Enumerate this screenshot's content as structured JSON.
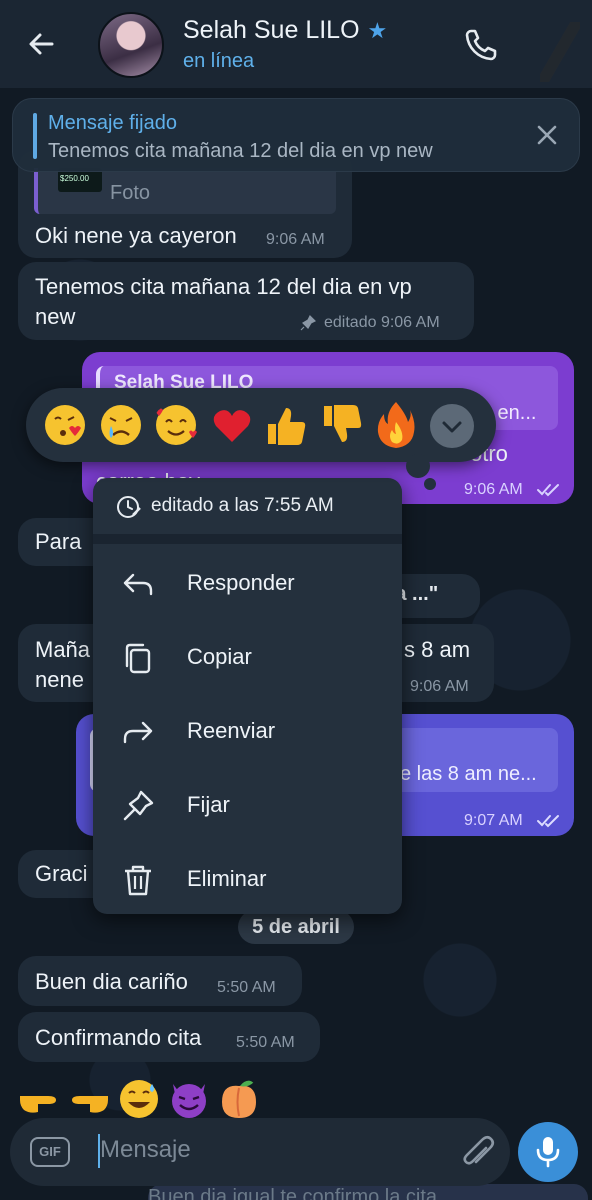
{
  "header": {
    "contact_name": "Selah Sue LILO",
    "status": "en línea"
  },
  "pinned": {
    "title": "Mensaje fijado",
    "text": "Tenemos cita mañana 12 del dia en vp new"
  },
  "messages": {
    "photo_label": "Foto",
    "photo_price": "$250.00",
    "m1_text": "Oki nene ya cayeron",
    "m1_time": "9:06 AM",
    "m2_line1": "Tenemos cita mañana 12 del dia en vp",
    "m2_line2": "new",
    "m2_time": "editado 9:06 AM",
    "m3_reply_name": "Selah Sue LILO",
    "m3_reply_tail": "s en...",
    "m3_text_tail": "otro",
    "m3_text_line2": "correo hoy",
    "m3_time": "9:06 AM",
    "m4_text": "Para",
    "m5_tail": "ana ...\"",
    "m6_line1_head": "Maña",
    "m6_line1_tail": "s 8 am",
    "m6_line2_head": "nene",
    "m6_time": "9:06 AM",
    "m7_reply_tail": "e las 8 am ne...",
    "m7_time": "9:07 AM",
    "m8_text": "Graci",
    "date_chip": "5 de abril",
    "m9_text": "Buen dia cariño",
    "m9_time": "5:50 AM",
    "m10_text": "Confirmando cita",
    "m10_time": "5:50 AM",
    "ghost_text": "Buen dia igual te confirmo la cita"
  },
  "context_menu": {
    "edited_label": "editado a las 7:55 AM",
    "items": [
      {
        "label": "Responder",
        "icon": "reply-icon"
      },
      {
        "label": "Copiar",
        "icon": "copy-icon"
      },
      {
        "label": "Reenviar",
        "icon": "forward-icon"
      },
      {
        "label": "Fijar",
        "icon": "pin-icon"
      },
      {
        "label": "Eliminar",
        "icon": "trash-icon"
      }
    ]
  },
  "reactions": [
    "kissing-heart",
    "crying",
    "smiling-hearts",
    "red-heart",
    "thumbs-up",
    "thumbs-down",
    "fire"
  ],
  "emoji_row": [
    "pointing-right",
    "pointing-left",
    "sweat-smile",
    "smiling-imp",
    "peach"
  ],
  "input": {
    "gif_label": "GIF",
    "placeholder": "Mensaje"
  },
  "colors": {
    "accent": "#5fb0ea",
    "outgoing_bubble": "#7c3dd0",
    "outgoing_bubble_2": "#5650d1",
    "incoming_bubble": "#1f2b38",
    "menu_bg": "#24303d"
  }
}
